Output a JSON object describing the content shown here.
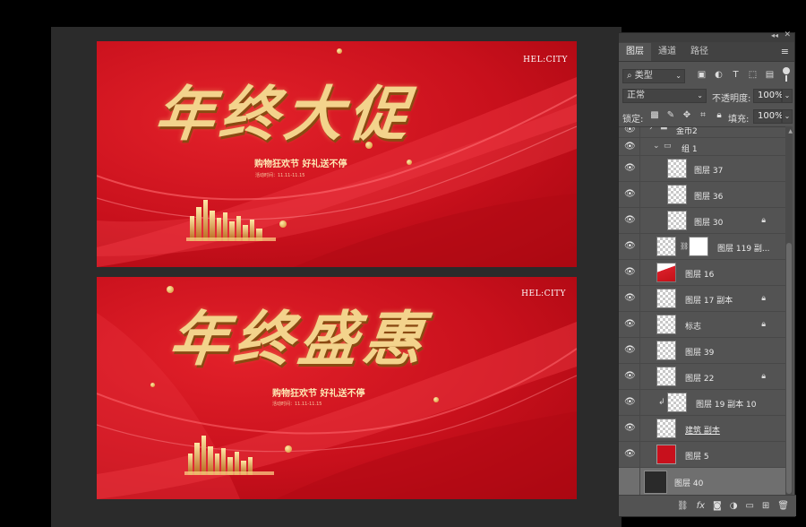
{
  "canvas": {
    "artboard1": {
      "headline": "年终大促",
      "brand": "HEL:CITY",
      "subline": "购物狂欢节 好礼送不停",
      "dateline": "活动时间：11.11-11.15"
    },
    "artboard2": {
      "headline": "年终盛惠",
      "brand": "HEL:CITY",
      "subline": "购物狂欢节 好礼送不停",
      "dateline": "活动时间：11.11-11.15"
    }
  },
  "panel": {
    "tabs": [
      "图层",
      "通道",
      "路径"
    ],
    "filter_kind": "类型",
    "blend_mode": "正常",
    "opacity_label": "不透明度:",
    "opacity_value": "100%",
    "lock_label": "锁定:",
    "fill_label": "填充:",
    "fill_value": "100%",
    "layers": [
      {
        "name": "金币2",
        "kind": "group-collapsed"
      },
      {
        "name": "组 1",
        "kind": "group-open"
      },
      {
        "name": "图层 37",
        "kind": "layer"
      },
      {
        "name": "图层 36",
        "kind": "layer"
      },
      {
        "name": "图层 30",
        "kind": "layer",
        "locked": true
      },
      {
        "name": "图层 119 副...",
        "kind": "masked"
      },
      {
        "name": "图层 16",
        "kind": "layer"
      },
      {
        "name": "图层 17 副本",
        "kind": "layer",
        "locked": true
      },
      {
        "name": "标志",
        "kind": "layer",
        "locked": true
      },
      {
        "name": "图层 39",
        "kind": "layer"
      },
      {
        "name": "图层 22",
        "kind": "layer",
        "locked": true
      },
      {
        "name": "图层 19 副本 10",
        "kind": "clipped"
      },
      {
        "name": "建筑 副本",
        "kind": "layer"
      },
      {
        "name": "图层 5",
        "kind": "layer"
      },
      {
        "name": "图层 40",
        "kind": "layer",
        "selected": true
      }
    ],
    "bottom_icons": [
      "link-icon",
      "fx-icon",
      "mask-icon",
      "adjustment-icon",
      "folder-icon",
      "new-layer-icon",
      "trash-icon"
    ]
  }
}
